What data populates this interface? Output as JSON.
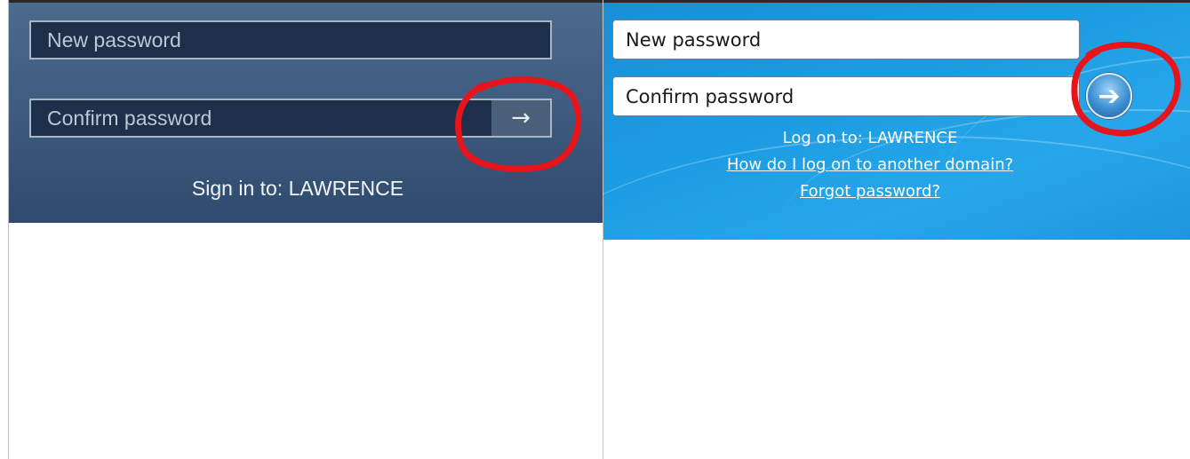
{
  "left_panel": {
    "new_password_placeholder": "New password",
    "confirm_password_placeholder": "Confirm password",
    "submit_arrow": "→",
    "sign_in_text": "Sign in to: LAWRENCE"
  },
  "right_panel": {
    "new_password_placeholder": "New password",
    "confirm_password_placeholder": "Confirm password",
    "submit_arrow": "➔",
    "log_on_text": "Log on to: LAWRENCE",
    "other_domain_link": "How do I log on to another domain?",
    "forgot_password_link": "Forgot password?"
  },
  "colors": {
    "annotation": "#e8141c",
    "win8_background": "#3f5d81",
    "win7_background": "#1c9be2"
  }
}
